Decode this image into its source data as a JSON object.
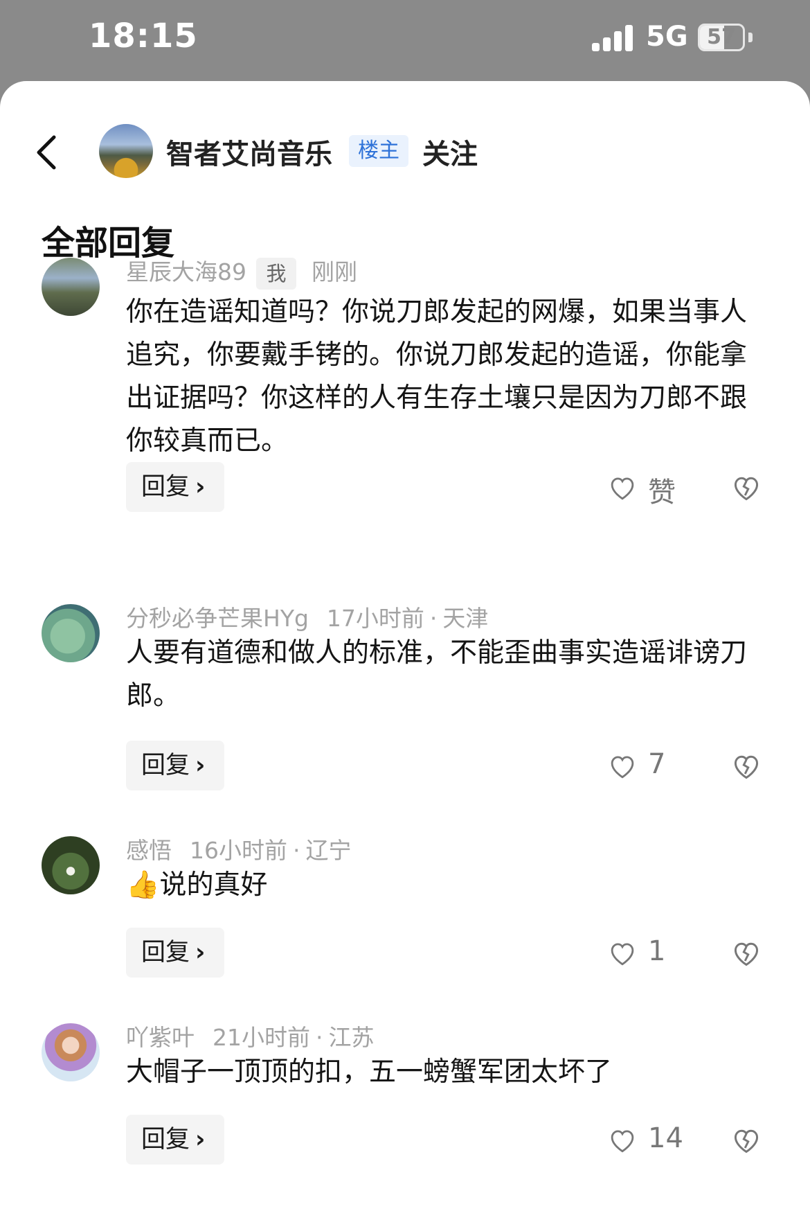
{
  "status_bar": {
    "time": "18:15",
    "network": "5G",
    "battery": "57",
    "battery_level": 0.57
  },
  "header": {
    "owner_name": "智者艾尚音乐",
    "owner_badge": "楼主",
    "follow_label": "关注"
  },
  "section_title": "全部回复",
  "comments": [
    {
      "author": "星辰大海89",
      "badge": "我",
      "time": "刚刚",
      "location": "",
      "text": "你在造谣知道吗？你说刀郎发起的网爆，如果当事人追究，你要戴手铐的。你说刀郎发起的造谣，你能拿出证据吗？你这样的人有生存土壤只是因为刀郎不跟你较真而已。",
      "reply_label": "回复",
      "likes": "赞"
    },
    {
      "author": "分秒必争芒果HYg",
      "badge": "",
      "time": "17小时前",
      "location": "天津",
      "text": "人要有道德和做人的标准，不能歪曲事实造谣诽谤刀郎。",
      "reply_label": "回复",
      "likes": "7"
    },
    {
      "author": "感悟",
      "badge": "",
      "time": "16小时前",
      "location": "辽宁",
      "text": "👍说的真好",
      "reply_label": "回复",
      "likes": "1"
    },
    {
      "author": "吖紫叶",
      "badge": "",
      "time": "21小时前",
      "location": "江苏",
      "text": "大帽子一顶顶的扣，五一螃蟹军团太坏了",
      "reply_label": "回复",
      "likes": "14"
    }
  ],
  "icons": {
    "back": "chevron-left-icon",
    "like": "heart-outline-icon",
    "dislike": "broken-heart-icon",
    "reply_arrow": "chevron-right-icon"
  }
}
